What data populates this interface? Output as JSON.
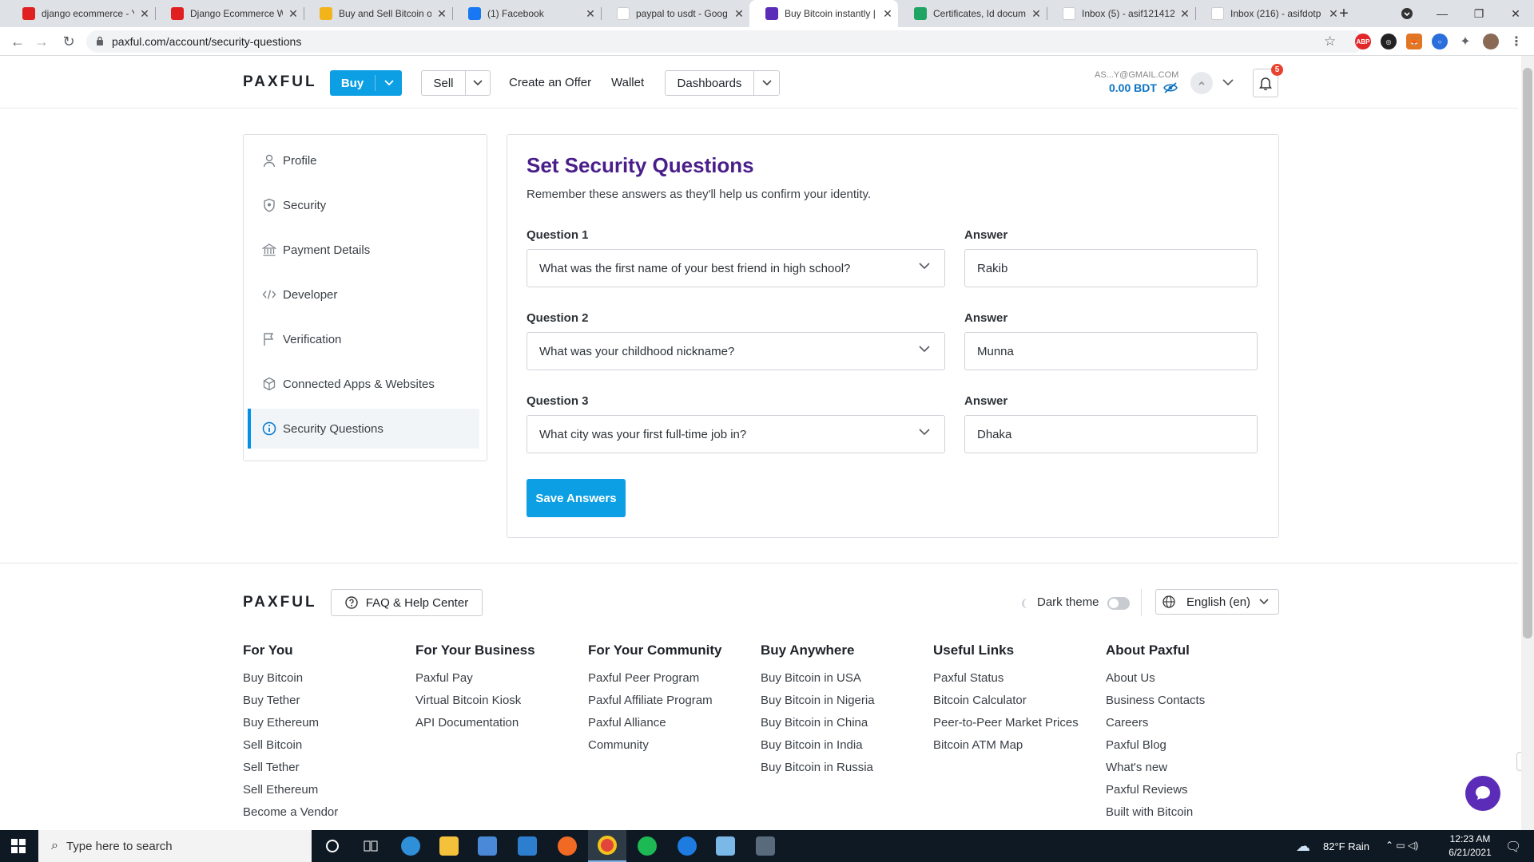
{
  "browser": {
    "tabs": [
      {
        "title": "django ecommerce - Y",
        "fav_color": "#e02020",
        "fav": "youtube-icon"
      },
      {
        "title": "Django Ecommerce W",
        "fav_color": "#e02020",
        "fav": "youtube-icon"
      },
      {
        "title": "Buy and Sell Bitcoin o",
        "fav_color": "#f2b31b",
        "fav": "binance-icon"
      },
      {
        "title": "(1) Facebook",
        "fav_color": "#1877f2",
        "fav": "facebook-icon"
      },
      {
        "title": "paypal to usdt - Goog",
        "fav_color": "#ffffff",
        "fav": "google-icon"
      },
      {
        "title": "Buy Bitcoin instantly |",
        "fav_color": "#5b2cb8",
        "fav": "paxful-icon",
        "active": true
      },
      {
        "title": "Certificates, Id docum",
        "fav_color": "#1fa463",
        "fav": "drive-icon"
      },
      {
        "title": "Inbox (5) - asif121412",
        "fav_color": "#ffffff",
        "fav": "gmail-icon"
      },
      {
        "title": "Inbox (216) - asifdotp",
        "fav_color": "#ffffff",
        "fav": "gmail-icon"
      }
    ],
    "url": "paxful.com/account/security-questions"
  },
  "header": {
    "logo": "PAXFUL",
    "buy": "Buy",
    "sell": "Sell",
    "create_offer": "Create an Offer",
    "wallet": "Wallet",
    "dashboards": "Dashboards",
    "email": "AS...Y@GMAIL.COM",
    "balance": "0.00 BDT",
    "notifications": "5"
  },
  "sidebar": {
    "items": [
      {
        "label": "Profile",
        "icon": "user-icon"
      },
      {
        "label": "Security",
        "icon": "shield-icon"
      },
      {
        "label": "Payment Details",
        "icon": "bank-icon"
      },
      {
        "label": "Developer",
        "icon": "code-icon"
      },
      {
        "label": "Verification",
        "icon": "flag-icon"
      },
      {
        "label": "Connected Apps & Websites",
        "icon": "cube-icon"
      },
      {
        "label": "Security Questions",
        "icon": "info-icon",
        "active": true
      }
    ]
  },
  "main": {
    "title": "Set Security Questions",
    "subtitle": "Remember these answers as they'll help us confirm your identity.",
    "answer_label": "Answer",
    "questions": [
      {
        "label": "Question 1",
        "question": "What was the first name of your best friend in high school?",
        "answer": "Rakib"
      },
      {
        "label": "Question 2",
        "question": "What was your childhood nickname?",
        "answer": "Munna"
      },
      {
        "label": "Question 3",
        "question": "What city was your first full-time job in?",
        "answer": "Dhaka"
      }
    ],
    "save": "Save Answers"
  },
  "footer": {
    "logo": "PAXFUL",
    "faq": "FAQ & Help Center",
    "dark_theme": "Dark theme",
    "language": "English (en)",
    "columns": [
      {
        "title": "For You",
        "links": [
          "Buy Bitcoin",
          "Buy Tether",
          "Buy Ethereum",
          "Sell Bitcoin",
          "Sell Tether",
          "Sell Ethereum",
          "Become a Vendor"
        ]
      },
      {
        "title": "For Your Business",
        "links": [
          "Paxful Pay",
          "Virtual Bitcoin Kiosk",
          "API Documentation"
        ]
      },
      {
        "title": "For Your Community",
        "links": [
          "Paxful Peer Program",
          "Paxful Affiliate Program",
          "Paxful Alliance",
          "Community"
        ]
      },
      {
        "title": "Buy Anywhere",
        "links": [
          "Buy Bitcoin in USA",
          "Buy Bitcoin in Nigeria",
          "Buy Bitcoin in China",
          "Buy Bitcoin in India",
          "Buy Bitcoin in Russia"
        ]
      },
      {
        "title": "Useful Links",
        "links": [
          "Paxful Status",
          "Bitcoin Calculator",
          "Peer-to-Peer Market Prices",
          "Bitcoin ATM Map"
        ]
      },
      {
        "title": "About Paxful",
        "links": [
          "About Us",
          "Business Contacts",
          "Careers",
          "Paxful Blog",
          "What's new",
          "Paxful Reviews",
          "Built with Bitcoin"
        ]
      }
    ]
  },
  "taskbar": {
    "search_placeholder": "Type here to search",
    "weather": "82°F  Rain",
    "time": "12:23 AM",
    "date": "6/21/2021"
  }
}
